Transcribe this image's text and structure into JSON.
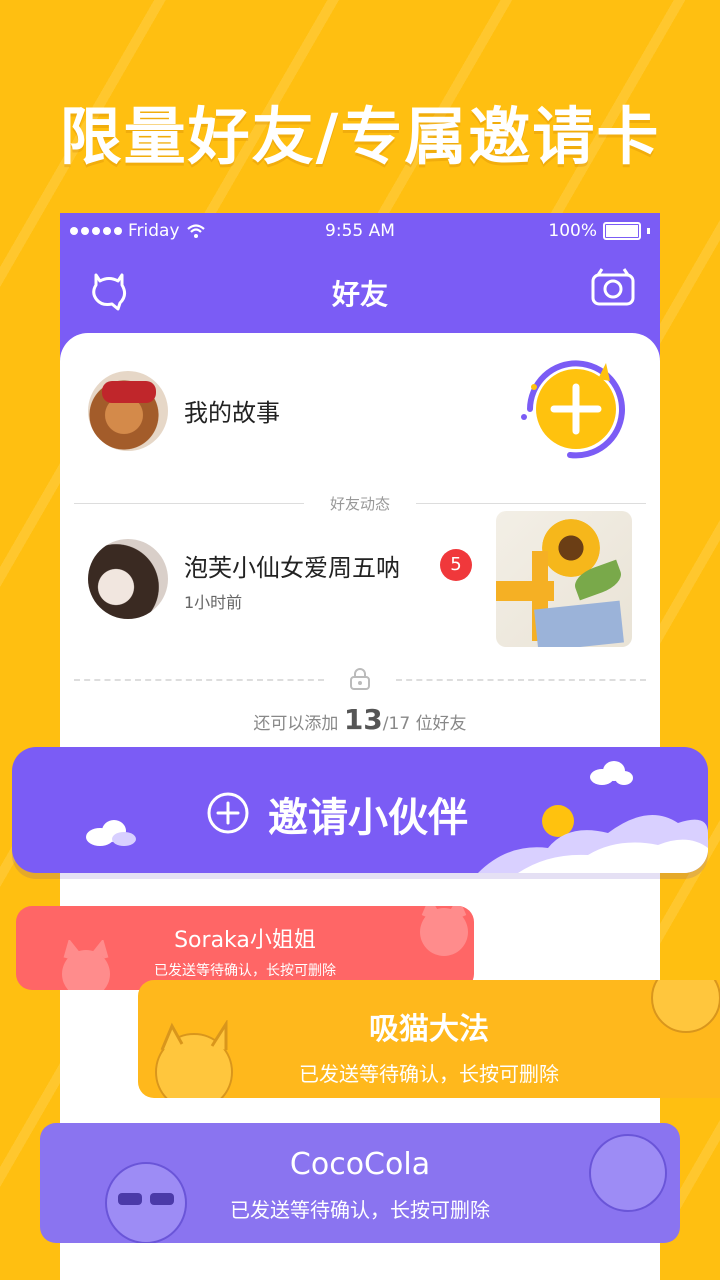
{
  "headline": "限量好友/专属邀请卡",
  "status_bar": {
    "carrier": "Friday",
    "time": "9:55 AM",
    "battery": "100%"
  },
  "nav": {
    "title": "好友",
    "left_icon": "ghost-chat-icon",
    "right_icon": "camera-icon"
  },
  "my_story": {
    "label": "我的故事"
  },
  "feed_section_title": "好友动态",
  "feed": [
    {
      "name": "泡芙小仙女爱周五呐",
      "badge": "5",
      "time": "1小时前"
    }
  ],
  "quota": {
    "prefix": "还可以添加",
    "count": "13",
    "total": "/17",
    "suffix": "位好友"
  },
  "invite_button": {
    "label": "邀请小伙伴"
  },
  "requests": [
    {
      "name": "Soraka小姐姐",
      "status": "已发送等待确认，长按可删除"
    },
    {
      "name": "吸猫大法",
      "status": "已发送等待确认，长按可删除"
    },
    {
      "name": "CocoCola",
      "status": "已发送等待确认，长按可删除"
    }
  ],
  "colors": {
    "background": "#FFBF11",
    "purple": "#7B5CF5",
    "badge_red": "#F0383B",
    "card_red": "#FF6666",
    "card_orange": "#FFB81C",
    "card_violet": "#8A74F0"
  }
}
